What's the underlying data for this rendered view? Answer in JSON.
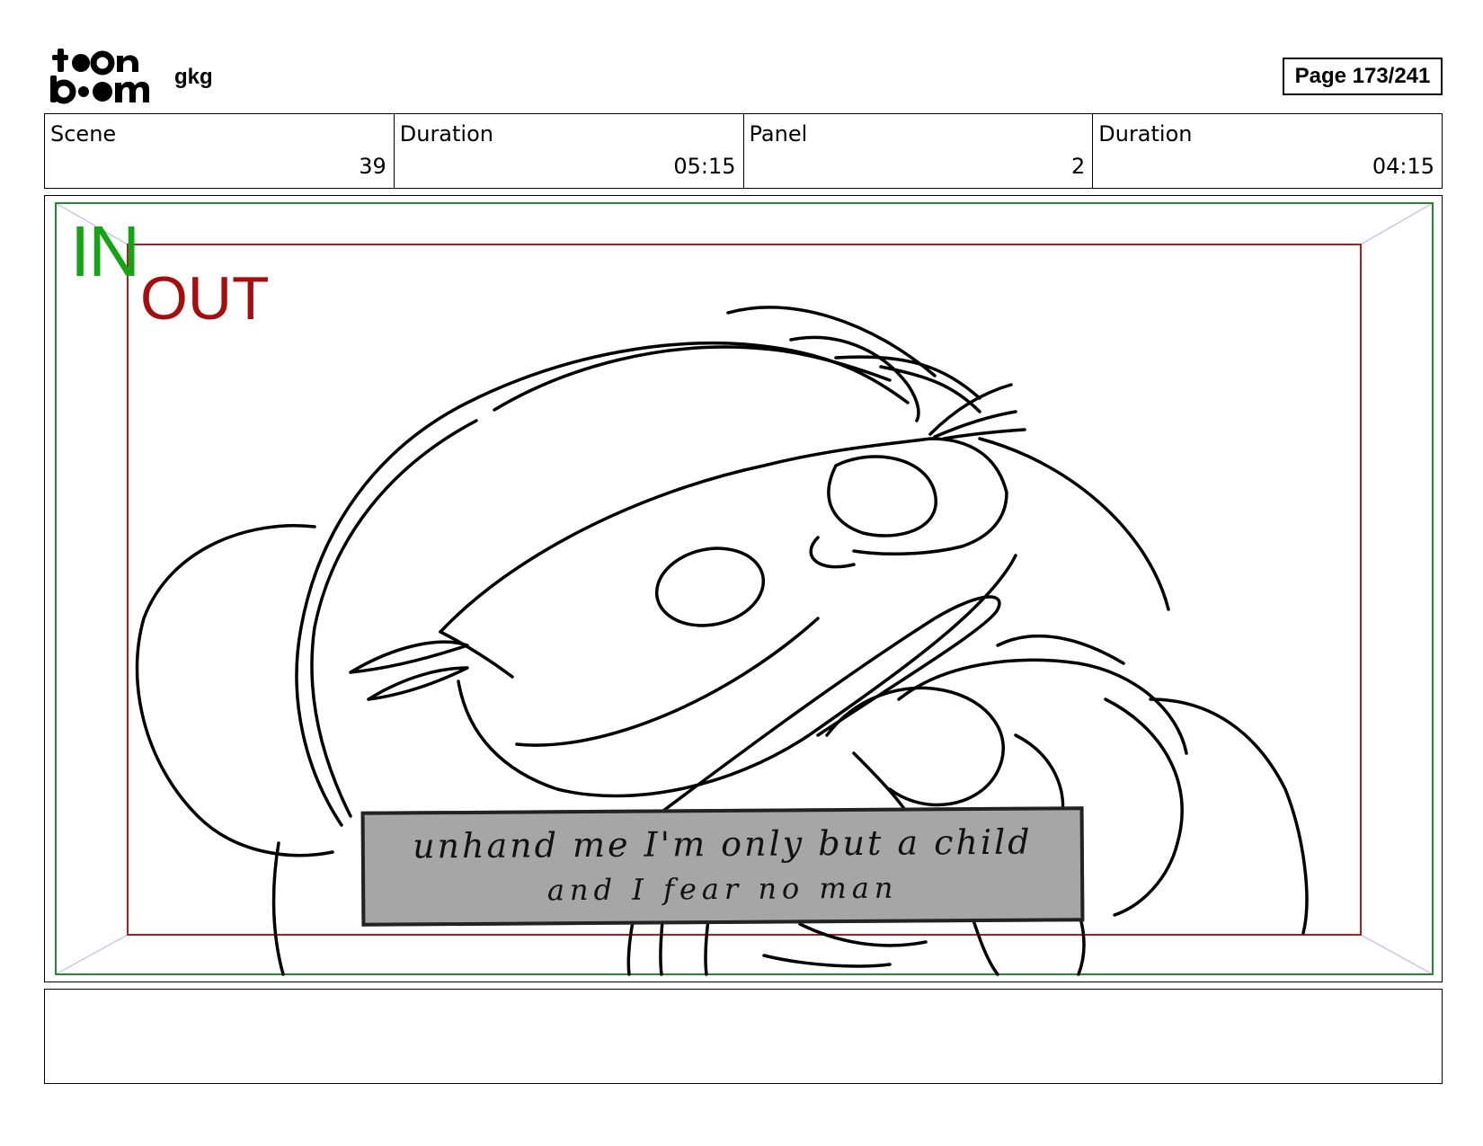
{
  "header": {
    "logo_top": "t●●n",
    "logo_bottom": "b●●m",
    "project_name": "gkg",
    "page_label": "Page 173/241"
  },
  "info": [
    {
      "label": "Scene",
      "value": "39"
    },
    {
      "label": "Duration",
      "value": "05:15"
    },
    {
      "label": "Panel",
      "value": "2"
    },
    {
      "label": "Duration",
      "value": "04:15"
    }
  ],
  "panel": {
    "in_label": "IN",
    "out_label": "OUT",
    "in_color": "#16a316",
    "out_color": "#a30f0f",
    "caption_line_1": "unhand me I'm only but a child",
    "caption_line_2": "and I fear no man"
  },
  "notes": ""
}
